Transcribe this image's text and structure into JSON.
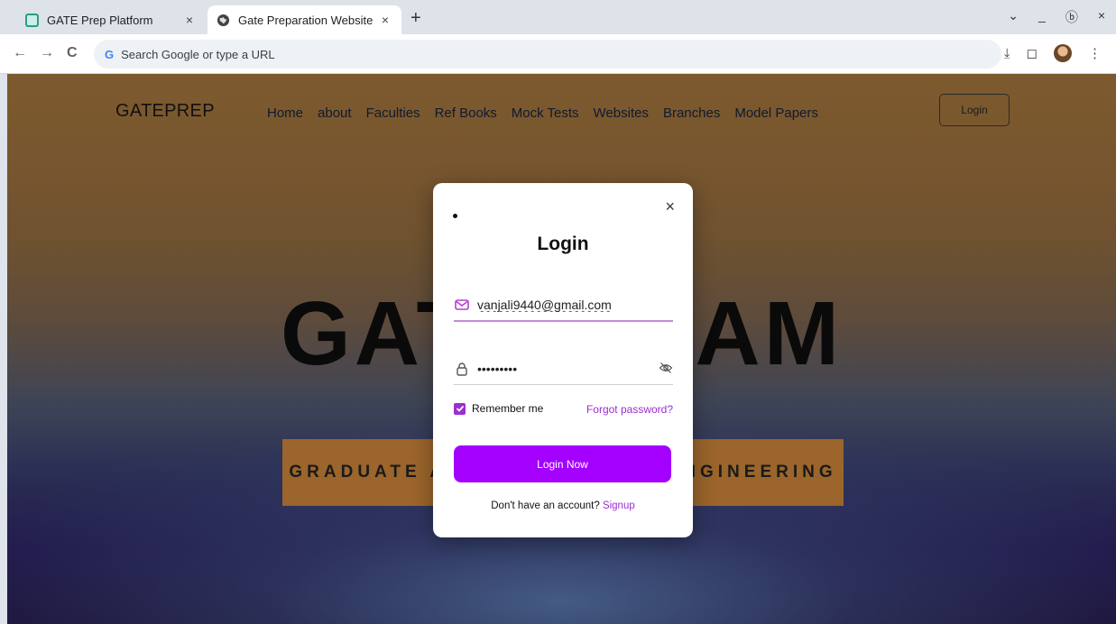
{
  "browser": {
    "tabs": [
      {
        "title": "GATE Prep Platform",
        "close": "×"
      },
      {
        "title": "Gate Preparation Website",
        "close": "×"
      }
    ],
    "new_tab": "+",
    "omnibox_placeholder": "Search Google or type a URL",
    "omnibox_logo": "G",
    "nav": {
      "back": "←",
      "forward": "→",
      "reload": "C"
    },
    "window_controls": {
      "menu": "⌄",
      "minimize": "_",
      "restore": "ⓑ",
      "close": "×"
    },
    "toolbar_icons": {
      "download": "⤓",
      "sidepanel": "◻",
      "menu": "⋮"
    }
  },
  "site": {
    "brand": "GATEPREP",
    "nav_links": [
      "Home",
      "about",
      "Faculties",
      "Ref Books",
      "Mock Tests",
      "Websites",
      "Branches",
      "Model Papers"
    ],
    "login_button": "Login",
    "hero_title": "GATE EXAM",
    "hero_banner": "GRADUATE APTITUDE TEST IN ENGINEERING"
  },
  "login_modal": {
    "dot": "•",
    "close": "×",
    "title": "Login",
    "email_value": "vanjali9440@gmail.com",
    "password_value": "•••••••••",
    "remember_label": "Remember me",
    "remember_checked": true,
    "forgot_link": "Forgot password?",
    "submit_label": "Login Now",
    "signup_prompt": "Don't have an account?",
    "signup_link": "Signup",
    "accent_color": "#a300ff"
  }
}
